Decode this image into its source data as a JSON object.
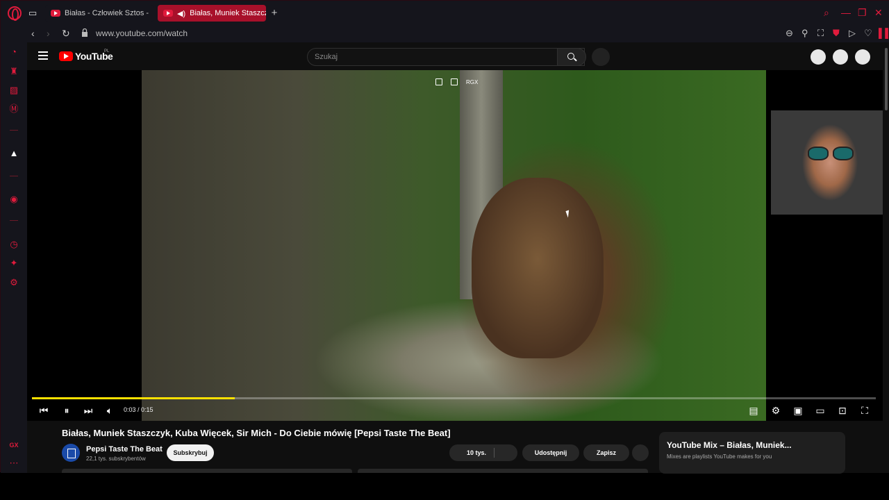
{
  "browser": {
    "tabs": [
      {
        "label": "Białas - Człowiek Sztos -"
      },
      {
        "label": "Białas, Muniek Staszczyk"
      }
    ],
    "url": "www.youtube.com/watch",
    "accent": "#e01b3c"
  },
  "sidebar": {
    "bottom_label": "GX"
  },
  "youtube": {
    "logo_text": "YouTube",
    "logo_region": "PL",
    "search_placeholder": "Szukaj"
  },
  "player": {
    "overlay_label": "RGX",
    "time": "0:03 / 0:15",
    "progress_played": 0.24,
    "progress_loaded": 0.24
  },
  "video_info": {
    "title": "Białas, Muniek Staszczyk, Kuba Więcek, Sir Mich - Do Ciebie mówię [Pepsi Taste The Beat]",
    "channel_name": "Pepsi Taste The Beat",
    "channel_subs": "22,1 tys. subskrybentów",
    "subscribe_label": "Subskrybuj",
    "likes_label": "10 tys.",
    "share_label": "Udostępnij",
    "save_label": "Zapisz"
  },
  "mix": {
    "title": "YouTube Mix – Białas, Muniek...",
    "subtitle": "Mixes are playlists YouTube makes for you"
  }
}
